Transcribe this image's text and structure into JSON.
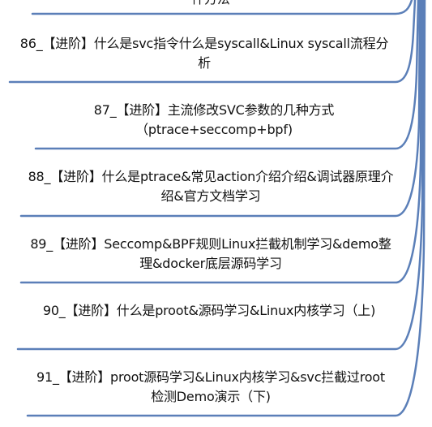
{
  "line_color": "#5b7fb8",
  "text_color": "#111111",
  "nodes": [
    {
      "title": "件方法"
    },
    {
      "title": "86_【进阶】什么是svc指令什么是syscall&Linux syscall流程分析"
    },
    {
      "title": "87_【进阶】主流修改SVC参数的几种方式（ptrace+seccomp+bpf)"
    },
    {
      "title": "88_【进阶】什么是ptrace&常见action介绍介绍&调试器原理介绍&官方文档学习"
    },
    {
      "title": "89_【进阶】Seccomp&BPF规则Linux拦截机制学习&demo整理&docker底层源码学习"
    },
    {
      "title": "90_【进阶】什么是proot&源码学习&Linux内核学习（上)"
    },
    {
      "title": "91_【进阶】proot源码学习&Linux内核学习&svc拦截过root检测Demo演示（下)"
    }
  ]
}
